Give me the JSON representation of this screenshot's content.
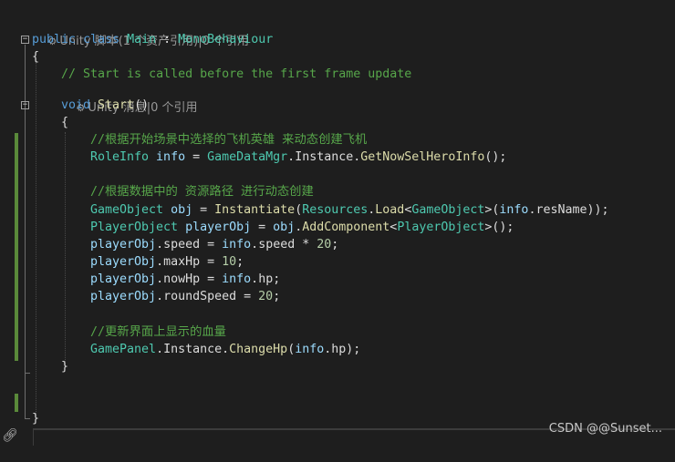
{
  "editor": {
    "lens_class": "Unity 脚本(1 个资产引用)|0 个引用",
    "lens_method": "Unity 消息|0 个引用",
    "lens_icon": "unity-icon",
    "lines": {
      "l1_public": "public",
      "l1_class": " class ",
      "l1_main": "Main",
      "l1_colon": " : ",
      "l1_mono": "MonoBehaviour",
      "l2": "{",
      "l3_comment": "// Start is called before the first frame update",
      "l4_void": "void",
      "l4_start": " Start",
      "l4_paren": "()",
      "l5": "{",
      "l6_comment": "//根据开始场景中选择的飞机英雄 来动态创建飞机",
      "l7_type": "RoleInfo",
      "l7_var": " info",
      "l7_eq": " = ",
      "l7_mgr": "GameDataMgr",
      "l7_dot1": ".",
      "l7_inst": "Instance",
      "l7_dot2": ".",
      "l7_method": "GetNowSelHeroInfo",
      "l7_end": "();",
      "l8_comment": "//根据数据中的 资源路径 进行动态创建",
      "l9_type": "GameObject",
      "l9_var": " obj",
      "l9_eq": " = ",
      "l9_method": "Instantiate",
      "l9_p1": "(",
      "l9_res": "Resources",
      "l9_dot": ".",
      "l9_load": "Load",
      "l9_lt": "<",
      "l9_go": "GameObject",
      "l9_gt": ">(",
      "l9_info": "info",
      "l9_dot2": ".",
      "l9_resname": "resName",
      "l9_end": "));",
      "l10_type": "PlayerObject",
      "l10_var": " playerObj",
      "l10_eq": " = ",
      "l10_obj": "obj",
      "l10_dot": ".",
      "l10_method": "AddComponent",
      "l10_lt": "<",
      "l10_po": "PlayerObject",
      "l10_end": ">();",
      "l11_var": "playerObj",
      "l11_dot": ".",
      "l11_prop": "speed",
      "l11_eq": " = ",
      "l11_info": "info",
      "l11_dot2": ".",
      "l11_speed": "speed",
      "l11_op": " * ",
      "l11_num": "20",
      "l11_end": ";",
      "l12_var": "playerObj",
      "l12_dot": ".",
      "l12_prop": "maxHp",
      "l12_eq": " = ",
      "l12_num": "10",
      "l12_end": ";",
      "l13_var": "playerObj",
      "l13_dot": ".",
      "l13_prop": "nowHp",
      "l13_eq": " = ",
      "l13_info": "info",
      "l13_dot2": ".",
      "l13_hp": "hp",
      "l13_end": ";",
      "l14_var": "playerObj",
      "l14_dot": ".",
      "l14_prop": "roundSpeed",
      "l14_eq": " = ",
      "l14_num": "20",
      "l14_end": ";",
      "l15_comment": "//更新界面上显示的血量",
      "l16_type": "GamePanel",
      "l16_dot": ".",
      "l16_inst": "Instance",
      "l16_dot2": ".",
      "l16_method": "ChangeHp",
      "l16_p": "(",
      "l16_info": "info",
      "l16_dot3": ".",
      "l16_hp": "hp",
      "l16_end": ");",
      "l17": "}",
      "l18": "}"
    },
    "fold_collapse_glyph": "−"
  },
  "watermark": "CSDN @@Sunset...",
  "colors": {
    "background": "#1e1e1e",
    "keyword": "#569cd6",
    "type": "#4ec9b0",
    "method": "#dcdcaa",
    "variable": "#9cdcfe",
    "number": "#b5cea8",
    "comment": "#57a64a",
    "change_bar": "#5a8a3a"
  }
}
